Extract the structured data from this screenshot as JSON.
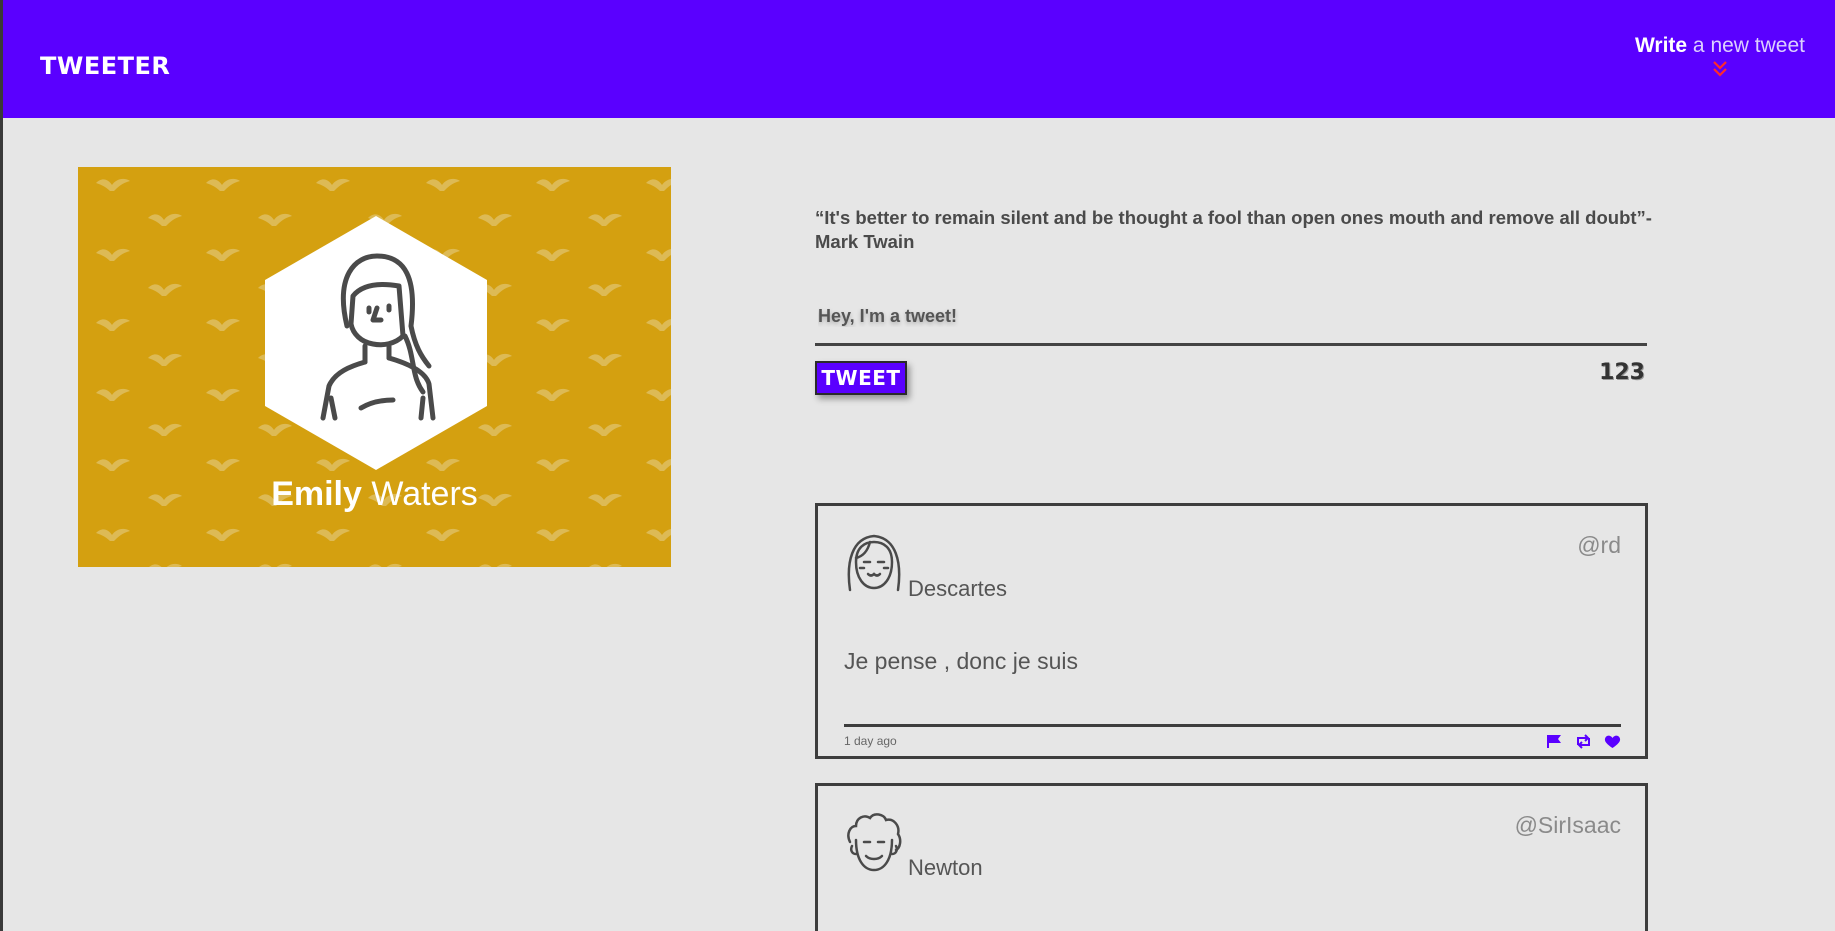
{
  "header": {
    "logo": "TWEETER",
    "compose_strong": "Write",
    "compose_rest": " a new tweet",
    "compose_icon": "double-chevron-down-icon",
    "accent": "#5a00ff",
    "chevron_color": "#ff2a2a"
  },
  "profile": {
    "first_name": "Emily",
    "last_name": " Waters",
    "background": "#d4a010",
    "avatar_icon": "woman-avatar-icon",
    "pattern_icon": "bird-pattern"
  },
  "composer": {
    "quote": "“It's better to remain silent and be thought a fool than open ones mouth and remove all doubt”- Mark Twain",
    "input_value": "Hey, I'm a tweet!",
    "button_label": "TWEET",
    "char_count": "123"
  },
  "tweets": [
    {
      "author": "Descartes",
      "handle": "@rd",
      "text": "Je pense , donc je suis",
      "time": "1 day ago",
      "avatar_icon": "girl-avatar-icon",
      "actions": [
        "flag-icon",
        "retweet-icon",
        "heart-icon"
      ]
    },
    {
      "author": "Newton",
      "handle": "@SirIsaac",
      "avatar_icon": "curly-man-avatar-icon"
    }
  ]
}
